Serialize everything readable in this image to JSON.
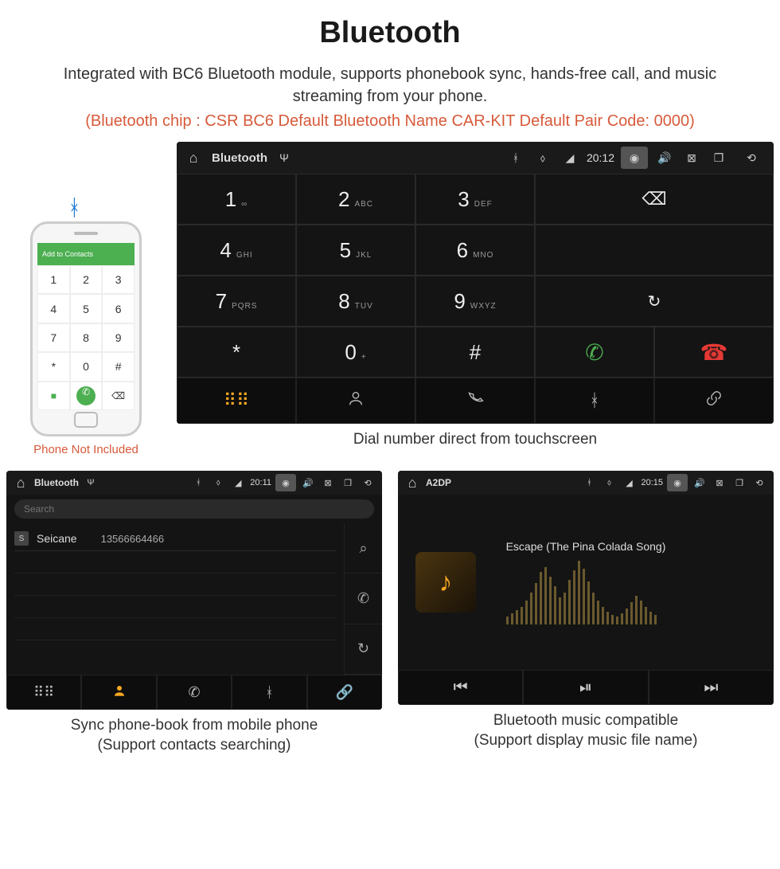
{
  "title": "Bluetooth",
  "subtitle": "Integrated with BC6 Bluetooth module, supports phonebook sync, hands-free call, and music streaming from your phone.",
  "specs": "(Bluetooth chip : CSR BC6    Default Bluetooth Name CAR-KIT    Default Pair Code: 0000)",
  "phone_note": "Phone Not Included",
  "phone_header": "Add to Contacts",
  "dialer": {
    "status_title": "Bluetooth",
    "time": "20:12",
    "keys": [
      {
        "d": "1",
        "s": "∞"
      },
      {
        "d": "2",
        "s": "ABC"
      },
      {
        "d": "3",
        "s": "DEF"
      },
      {
        "d": "4",
        "s": "GHI"
      },
      {
        "d": "5",
        "s": "JKL"
      },
      {
        "d": "6",
        "s": "MNO"
      },
      {
        "d": "7",
        "s": "PQRS"
      },
      {
        "d": "8",
        "s": "TUV"
      },
      {
        "d": "9",
        "s": "WXYZ"
      },
      {
        "d": "*",
        "s": ""
      },
      {
        "d": "0",
        "s": "+"
      },
      {
        "d": "#",
        "s": ""
      }
    ],
    "caption": "Dial number direct from touchscreen"
  },
  "phonebook": {
    "status_title": "Bluetooth",
    "time": "20:11",
    "search_placeholder": "Search",
    "contact_badge": "S",
    "contact_name": "Seicane",
    "contact_number": "13566664466",
    "caption1": "Sync phone-book from mobile phone",
    "caption2": "(Support contacts searching)"
  },
  "music": {
    "status_title": "A2DP",
    "time": "20:15",
    "track": "Escape (The Pina Colada Song)",
    "viz": [
      10,
      14,
      18,
      22,
      30,
      40,
      52,
      66,
      72,
      60,
      48,
      34,
      40,
      56,
      68,
      80,
      70,
      54,
      40,
      30,
      22,
      16,
      12,
      10,
      14,
      20,
      28,
      36,
      30,
      22,
      16,
      12
    ],
    "caption1": "Bluetooth music compatible",
    "caption2": "(Support display music file name)"
  }
}
